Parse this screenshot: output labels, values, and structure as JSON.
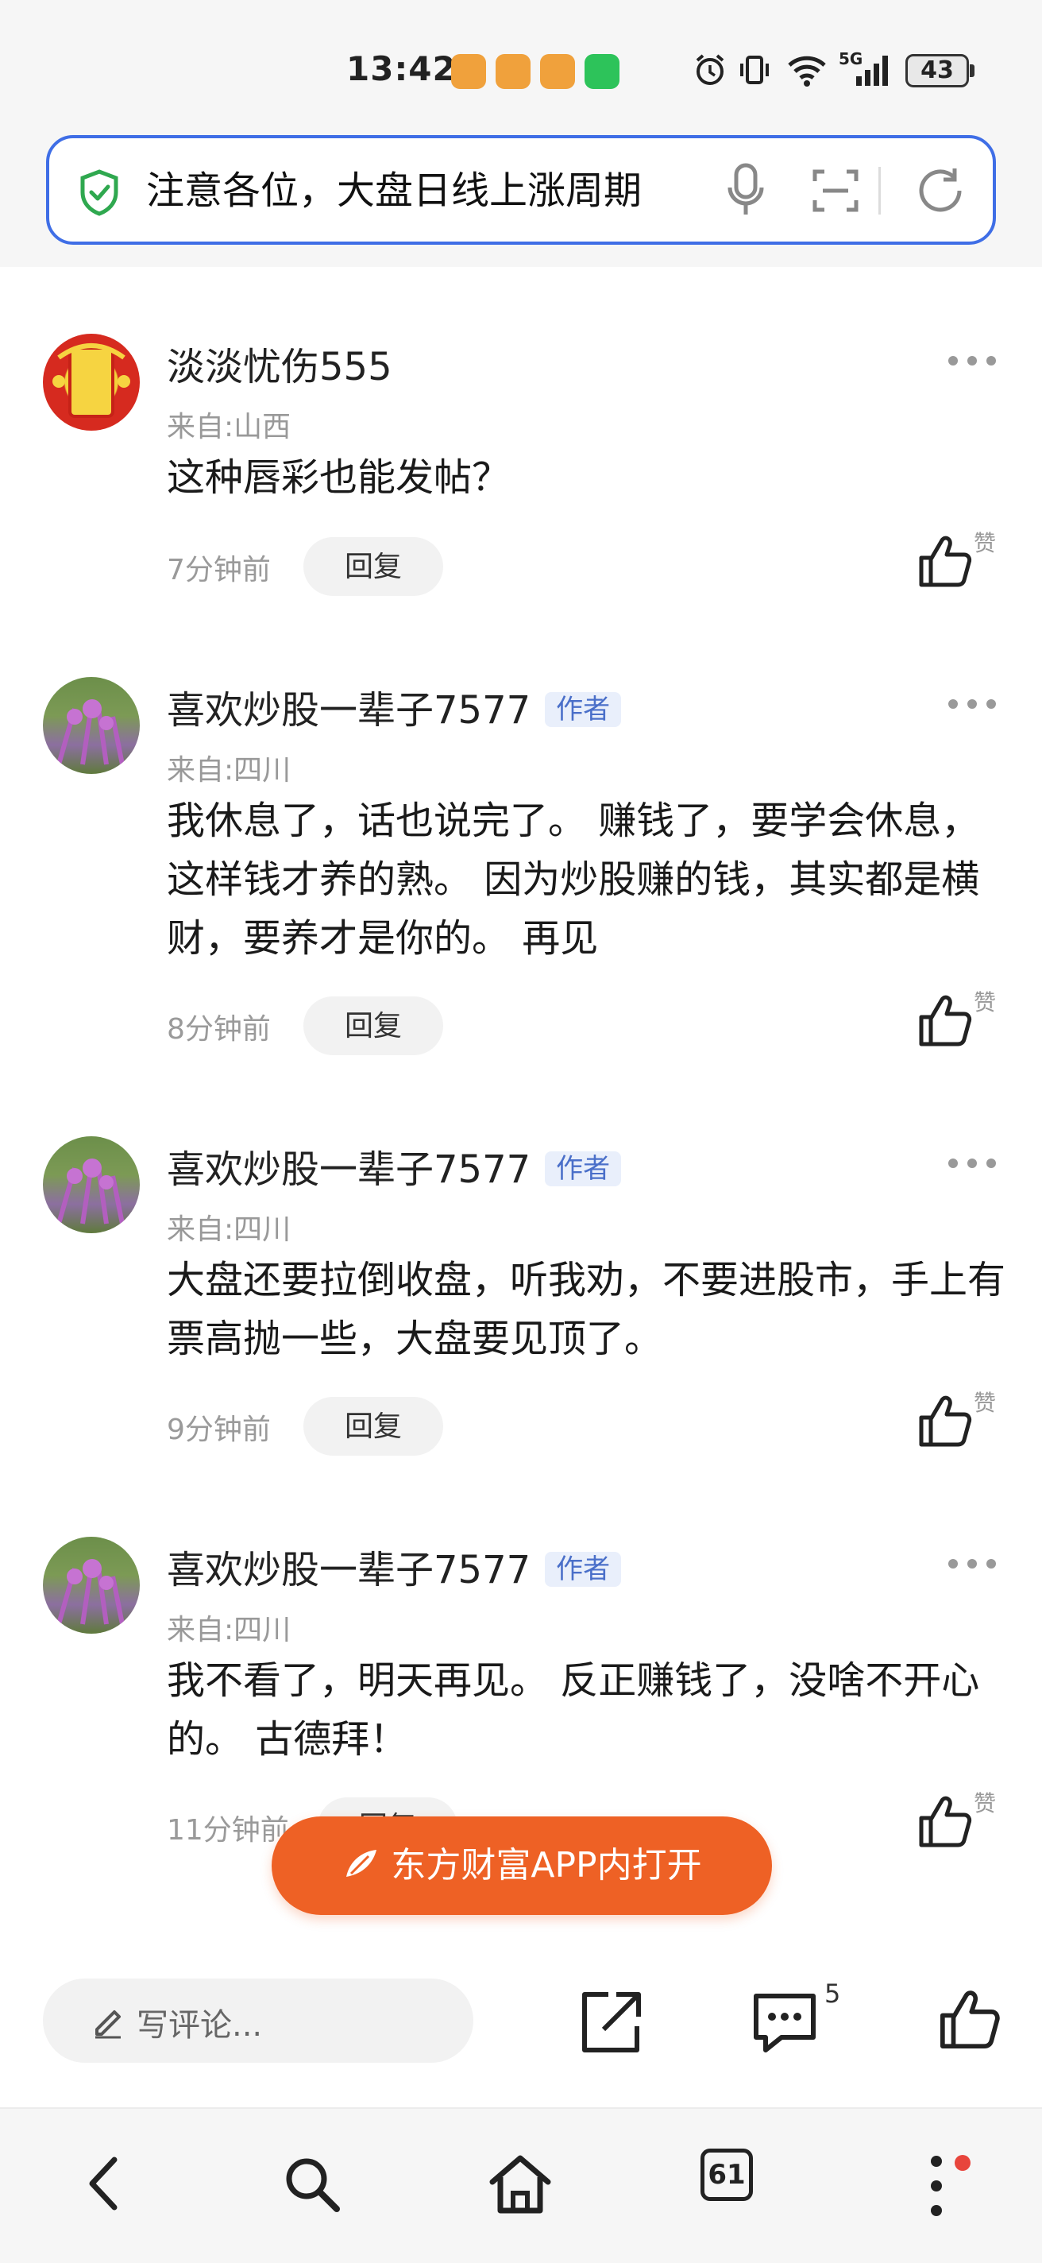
{
  "status_bar": {
    "time": "13:42",
    "battery": "43",
    "network": "5G"
  },
  "search": {
    "query": "注意各位，大盘日线上涨周期"
  },
  "comments": [
    {
      "username": "淡淡忧伤555",
      "is_author": false,
      "author_label": "",
      "location": "来自:山西",
      "text": "这种唇彩也能发帖？",
      "time": "7分钟前",
      "reply_label": "回复",
      "like_label": "赞"
    },
    {
      "username": "喜欢炒股一辈子7577",
      "is_author": true,
      "author_label": "作者",
      "location": "来自:四川",
      "text": "我休息了，话也说完了。 赚钱了，要学会休息，这样钱才养的熟。 因为炒股赚的钱，其实都是横财，要养才是你的。 再见",
      "time": "8分钟前",
      "reply_label": "回复",
      "like_label": "赞"
    },
    {
      "username": "喜欢炒股一辈子7577",
      "is_author": true,
      "author_label": "作者",
      "location": "来自:四川",
      "text": "大盘还要拉倒收盘，听我劝，不要进股市，手上有票高抛一些，大盘要见顶了。",
      "time": "9分钟前",
      "reply_label": "回复",
      "like_label": "赞"
    },
    {
      "username": "喜欢炒股一辈子7577",
      "is_author": true,
      "author_label": "作者",
      "location": "来自:四川",
      "text": "我不看了，明天再见。 反正赚钱了，没啥不开心的。 古德拜！",
      "time": "11分钟前",
      "reply_label": "回复",
      "like_label": "赞"
    }
  ],
  "open_app": {
    "label": "东方财富APP内打开"
  },
  "toolbar": {
    "write_placeholder": "写评论...",
    "comment_count": "5"
  },
  "navbar": {
    "tabs_count": "61"
  },
  "colors": {
    "accent_blue": "#3f6ee6",
    "open_app_orange": "#ee6125",
    "shield_green": "#2fa84f",
    "author_badge_text": "#4a6fc9"
  },
  "icons": [
    "shield-check-icon",
    "microphone-icon",
    "scan-icon",
    "refresh-icon",
    "more-dots-icon",
    "thumbs-up-icon",
    "pencil-icon",
    "share-icon",
    "comment-icon",
    "back-icon",
    "search-icon",
    "home-icon",
    "menu-dots-icon"
  ]
}
